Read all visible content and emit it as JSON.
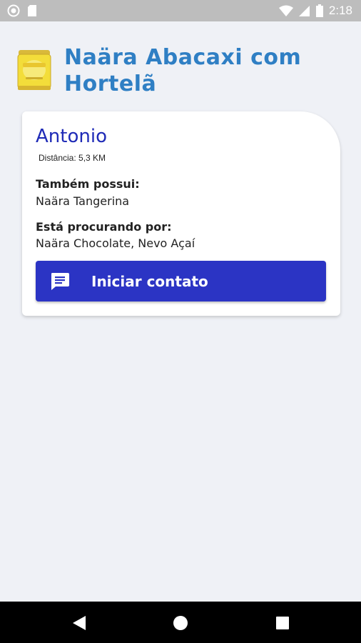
{
  "status_bar": {
    "time": "2:18",
    "icons": [
      "circle-status-icon",
      "sd-card-icon",
      "wifi-icon",
      "signal-icon",
      "battery-icon"
    ]
  },
  "header": {
    "product_name": "Naära Abacaxi com Hortelã",
    "product_icon": "product-can-icon",
    "title_color": "#2f7fc4"
  },
  "match_card": {
    "user_name": "Antonio",
    "distance": "Distância: 5,3 KM",
    "also_has_label": "Também possui:",
    "also_has_value": "Naära Tangerina",
    "looking_for_label": "Está procurando por:",
    "looking_for_value": "Naära Chocolate, Nevo Açaí",
    "contact_button_label": "Iniciar contato",
    "contact_button_icon": "chat-icon",
    "name_color": "#1f2bb7",
    "button_color": "#2b34c4"
  },
  "nav_bar": {
    "icons": [
      "back-icon",
      "home-icon",
      "recents-icon"
    ]
  }
}
